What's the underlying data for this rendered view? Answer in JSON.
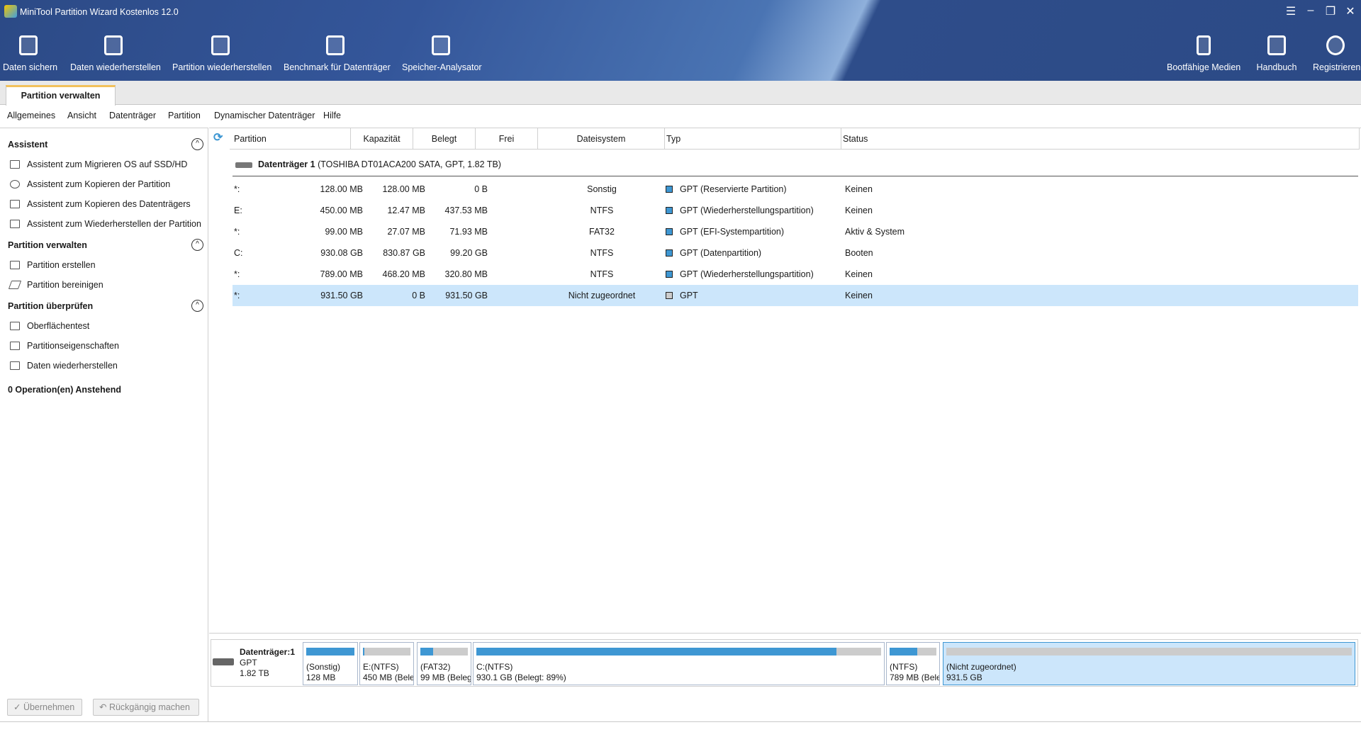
{
  "app": {
    "title": "MiniTool Partition Wizard Kostenlos 12.0"
  },
  "toolbar": {
    "left": [
      {
        "label": "Daten sichern",
        "icon": "backup-icon"
      },
      {
        "label": "Daten wiederherstellen",
        "icon": "data-recovery-icon"
      },
      {
        "label": "Partition wiederherstellen",
        "icon": "partition-recovery-icon"
      },
      {
        "label": "Benchmark für Datenträger",
        "icon": "disk-benchmark-icon"
      },
      {
        "label": "Speicher-Analysator",
        "icon": "space-analyzer-icon"
      }
    ],
    "right": [
      {
        "label": "Bootfähige Medien",
        "icon": "usb-icon"
      },
      {
        "label": "Handbuch",
        "icon": "book-icon"
      },
      {
        "label": "Registrieren",
        "icon": "register-user-icon"
      }
    ]
  },
  "tab": "Partition verwalten",
  "menu": [
    "Allgemeines",
    "Ansicht",
    "Datenträger",
    "Partition",
    "Dynamischer Datenträger",
    "Hilfe"
  ],
  "sidebar": {
    "sections": [
      {
        "title": "Assistent",
        "items": [
          "Assistent zum Migrieren OS auf SSD/HD",
          "Assistent zum Kopieren der Partition",
          "Assistent zum Kopieren des Datenträgers",
          "Assistent zum Wiederherstellen der Partition"
        ]
      },
      {
        "title": "Partition verwalten",
        "items": [
          "Partition erstellen",
          "Partition bereinigen"
        ]
      },
      {
        "title": "Partition überprüfen",
        "items": [
          "Oberflächentest",
          "Partitionseigenschaften",
          "Daten wiederherstellen"
        ]
      }
    ],
    "pending": "0 Operation(en) Anstehend"
  },
  "table": {
    "headers": [
      "Partition",
      "Kapazität",
      "Belegt",
      "Frei",
      "Dateisystem",
      "Typ",
      "Status"
    ],
    "disk": {
      "name": "Datenträger 1",
      "detail": "(TOSHIBA DT01ACA200 SATA, GPT, 1.82 TB)"
    },
    "rows": [
      {
        "p": "*:",
        "cap": "128.00 MB",
        "used": "128.00 MB",
        "free": "0 B",
        "fs": "Sonstig",
        "type": "GPT (Reservierte Partition)",
        "status": "Keinen",
        "color": "#3e97d3"
      },
      {
        "p": "E:",
        "cap": "450.00 MB",
        "used": "12.47 MB",
        "free": "437.53 MB",
        "fs": "NTFS",
        "type": "GPT (Wiederherstellungspartition)",
        "status": "Keinen",
        "color": "#3e97d3"
      },
      {
        "p": "*:",
        "cap": "99.00 MB",
        "used": "27.07 MB",
        "free": "71.93 MB",
        "fs": "FAT32",
        "type": "GPT (EFI-Systempartition)",
        "status": "Aktiv & System",
        "color": "#3e97d3"
      },
      {
        "p": "C:",
        "cap": "930.08 GB",
        "used": "830.87 GB",
        "free": "99.20 GB",
        "fs": "NTFS",
        "type": "GPT (Datenpartition)",
        "status": "Booten",
        "color": "#3e97d3"
      },
      {
        "p": "*:",
        "cap": "789.00 MB",
        "used": "468.20 MB",
        "free": "320.80 MB",
        "fs": "NTFS",
        "type": "GPT (Wiederherstellungspartition)",
        "status": "Keinen",
        "color": "#3e97d3"
      },
      {
        "p": "*:",
        "cap": "931.50 GB",
        "used": "0 B",
        "free": "931.50 GB",
        "fs": "Nicht zugeordnet",
        "type": "GPT",
        "status": "Keinen",
        "color": "#cccccc"
      }
    ]
  },
  "diskmap": {
    "name": "Datenträger:1",
    "scheme": "GPT",
    "size": "1.82 TB",
    "parts": [
      {
        "l1": "(Sonstig)",
        "l2": "128 MB",
        "used": 1.0
      },
      {
        "l1": "E:(NTFS)",
        "l2": "450 MB (Bele",
        "used": 0.03
      },
      {
        "l1": "(FAT32)",
        "l2": "99 MB (Beleg",
        "used": 0.27
      },
      {
        "l1": "C:(NTFS)",
        "l2": "930.1 GB (Belegt: 89%)",
        "used": 0.89
      },
      {
        "l1": "(NTFS)",
        "l2": "789 MB (Bele",
        "used": 0.59
      },
      {
        "l1": "(Nicht zugeordnet)",
        "l2": "931.5 GB",
        "used": 0
      }
    ]
  },
  "buttons": {
    "apply": "Übernehmen",
    "undo": "Rückgängig machen"
  },
  "colors": {
    "header": "#2c4a86",
    "used": "#3e97d3",
    "selected": "#cce6fb"
  }
}
